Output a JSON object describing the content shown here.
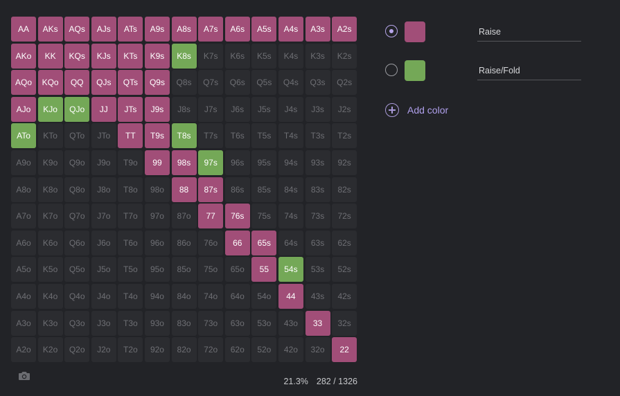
{
  "colors": {
    "raise": "#a14e78",
    "raise_fold": "#74a857",
    "empty": "#2b2c30"
  },
  "legend": [
    {
      "key": "raise",
      "label": "Raise",
      "selected": true
    },
    {
      "key": "raise_fold",
      "label": "Raise/Fold",
      "selected": false
    }
  ],
  "add_color_label": "Add color",
  "camera_icon": "camera-icon",
  "stats": {
    "percent": "21.3%",
    "combos": "282 / 1326"
  },
  "grid": [
    [
      "AA",
      "AKs",
      "AQs",
      "AJs",
      "ATs",
      "A9s",
      "A8s",
      "A7s",
      "A6s",
      "A5s",
      "A4s",
      "A3s",
      "A2s"
    ],
    [
      "AKo",
      "KK",
      "KQs",
      "KJs",
      "KTs",
      "K9s",
      "K8s",
      "K7s",
      "K6s",
      "K5s",
      "K4s",
      "K3s",
      "K2s"
    ],
    [
      "AQo",
      "KQo",
      "QQ",
      "QJs",
      "QTs",
      "Q9s",
      "Q8s",
      "Q7s",
      "Q6s",
      "Q5s",
      "Q4s",
      "Q3s",
      "Q2s"
    ],
    [
      "AJo",
      "KJo",
      "QJo",
      "JJ",
      "JTs",
      "J9s",
      "J8s",
      "J7s",
      "J6s",
      "J5s",
      "J4s",
      "J3s",
      "J2s"
    ],
    [
      "ATo",
      "KTo",
      "QTo",
      "JTo",
      "TT",
      "T9s",
      "T8s",
      "T7s",
      "T6s",
      "T5s",
      "T4s",
      "T3s",
      "T2s"
    ],
    [
      "A9o",
      "K9o",
      "Q9o",
      "J9o",
      "T9o",
      "99",
      "98s",
      "97s",
      "96s",
      "95s",
      "94s",
      "93s",
      "92s"
    ],
    [
      "A8o",
      "K8o",
      "Q8o",
      "J8o",
      "T8o",
      "98o",
      "88",
      "87s",
      "86s",
      "85s",
      "84s",
      "83s",
      "82s"
    ],
    [
      "A7o",
      "K7o",
      "Q7o",
      "J7o",
      "T7o",
      "97o",
      "87o",
      "77",
      "76s",
      "75s",
      "74s",
      "73s",
      "72s"
    ],
    [
      "A6o",
      "K6o",
      "Q6o",
      "J6o",
      "T6o",
      "96o",
      "86o",
      "76o",
      "66",
      "65s",
      "64s",
      "63s",
      "62s"
    ],
    [
      "A5o",
      "K5o",
      "Q5o",
      "J5o",
      "T5o",
      "95o",
      "85o",
      "75o",
      "65o",
      "55",
      "54s",
      "53s",
      "52s"
    ],
    [
      "A4o",
      "K4o",
      "Q4o",
      "J4o",
      "T4o",
      "94o",
      "84o",
      "74o",
      "64o",
      "54o",
      "44",
      "43s",
      "42s"
    ],
    [
      "A3o",
      "K3o",
      "Q3o",
      "J3o",
      "T3o",
      "93o",
      "83o",
      "73o",
      "63o",
      "53o",
      "43o",
      "33",
      "32s"
    ],
    [
      "A2o",
      "K2o",
      "Q2o",
      "J2o",
      "T2o",
      "92o",
      "82o",
      "72o",
      "62o",
      "52o",
      "42o",
      "32o",
      "22"
    ]
  ],
  "assignments": {
    "raise": [
      "AA",
      "AKs",
      "AQs",
      "AJs",
      "ATs",
      "A9s",
      "A8s",
      "A7s",
      "A6s",
      "A5s",
      "A4s",
      "A3s",
      "A2s",
      "AKo",
      "KK",
      "KQs",
      "KJs",
      "KTs",
      "K9s",
      "AQo",
      "KQo",
      "QQ",
      "QJs",
      "QTs",
      "Q9s",
      "AJo",
      "JJ",
      "JTs",
      "J9s",
      "TT",
      "T9s",
      "99",
      "98s",
      "88",
      "87s",
      "77",
      "76s",
      "66",
      "65s",
      "55",
      "44",
      "33",
      "22"
    ],
    "raise_fold": [
      "K8s",
      "KJo",
      "QJo",
      "ATo",
      "T8s",
      "97s",
      "54s"
    ]
  }
}
